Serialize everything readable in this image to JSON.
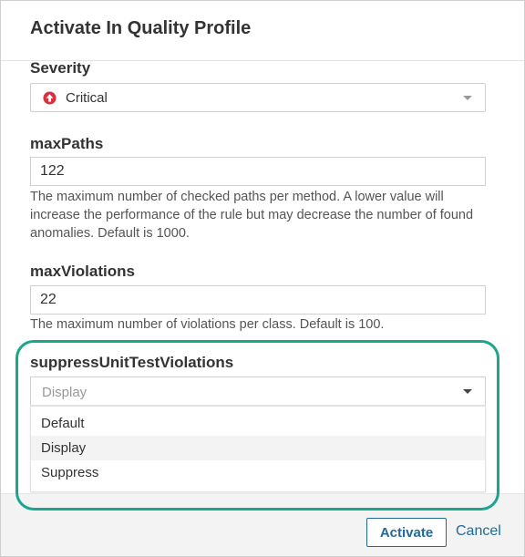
{
  "dialog": {
    "title": "Activate In Quality Profile"
  },
  "severity": {
    "label": "Severity",
    "value": "Critical",
    "icon": "critical-severity-icon",
    "icon_color": "#d4333f"
  },
  "params": [
    {
      "label": "maxPaths",
      "value": "122",
      "help": "The maximum number of checked paths per method. A lower value will increase the performance of the rule but may decrease the number of found anomalies. Default is 1000."
    },
    {
      "label": "maxViolations",
      "value": "22",
      "help": "The maximum number of violations per class. Default is 100."
    }
  ],
  "suppress": {
    "label": "suppressUnitTestViolations",
    "placeholder": "Display",
    "options": [
      "Default",
      "Display",
      "Suppress"
    ]
  },
  "footer": {
    "activate_label": "Activate",
    "cancel_label": "Cancel"
  },
  "colors": {
    "accent": "#236a97",
    "highlight": "#19a68e"
  }
}
